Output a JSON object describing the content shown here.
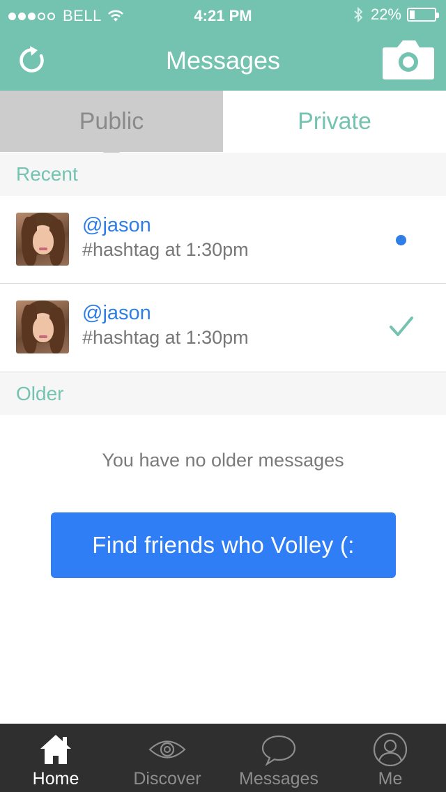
{
  "status_bar": {
    "carrier": "BELL",
    "time": "4:21 PM",
    "battery": "22%",
    "battery_level": 0.22
  },
  "nav": {
    "title": "Messages",
    "left_icon": "refresh-icon",
    "right_icon": "camera-icon"
  },
  "tabs": [
    {
      "label": "Public",
      "selected": true
    },
    {
      "label": "Private",
      "selected": false
    }
  ],
  "sections": {
    "recent": "Recent",
    "older": "Older"
  },
  "messages": [
    {
      "handle": "@jason",
      "subtitle": "#hashtag at 1:30pm",
      "status": "unread"
    },
    {
      "handle": "@jason",
      "subtitle": "#hashtag at 1:30pm",
      "status": "read"
    }
  ],
  "empty_older": "You have no older messages",
  "find_button": "Find friends who Volley (:",
  "colors": {
    "accent": "#74c3b0",
    "link": "#2f7ee8",
    "button": "#2f7ef5",
    "tabbar": "#2f2f2f"
  },
  "tabbar": [
    {
      "label": "Home",
      "icon": "home-icon",
      "active": true
    },
    {
      "label": "Discover",
      "icon": "eye-icon",
      "active": false
    },
    {
      "label": "Messages",
      "icon": "speech-bubble-icon",
      "active": false
    },
    {
      "label": "Me",
      "icon": "person-icon",
      "active": false
    }
  ]
}
